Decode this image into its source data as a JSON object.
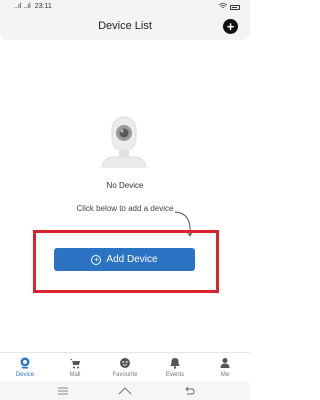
{
  "status": {
    "signal": "..ıl ..ıl",
    "time": "23:11",
    "battery_icon": "battery-icon"
  },
  "header": {
    "title": "Device List",
    "add_icon": "plus-icon"
  },
  "empty": {
    "label": "No Device",
    "hint": "Click below to add a device"
  },
  "add_button": {
    "label": "Add Device",
    "icon": "plus-circle-icon"
  },
  "tabs": [
    {
      "label": "Device",
      "icon": "camera-icon",
      "active": true
    },
    {
      "label": "Mall",
      "icon": "cart-icon",
      "active": false
    },
    {
      "label": "Favourite",
      "icon": "face-icon",
      "active": false
    },
    {
      "label": "Events",
      "icon": "bell-icon",
      "active": false
    },
    {
      "label": "Me",
      "icon": "person-icon",
      "active": false
    }
  ],
  "colors": {
    "accent": "#2c73c4",
    "highlight": "#d9232d",
    "header_bg": "#f4f4f4"
  }
}
